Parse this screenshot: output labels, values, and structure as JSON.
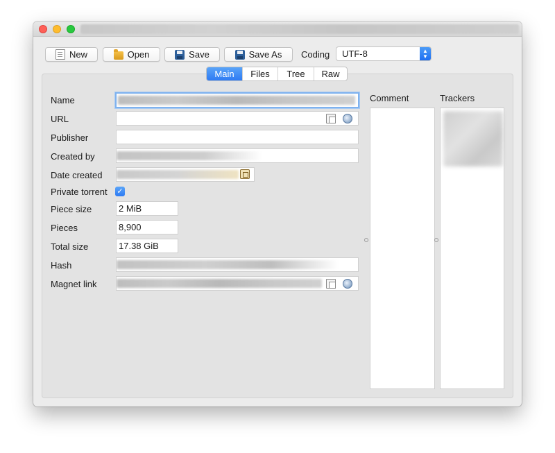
{
  "window": {
    "title": ""
  },
  "toolbar": {
    "new_label": "New",
    "open_label": "Open",
    "save_label": "Save",
    "save_as_label": "Save As",
    "coding_label": "Coding",
    "coding_value": "UTF-8"
  },
  "tabs": [
    {
      "label": "Main",
      "active": true
    },
    {
      "label": "Files",
      "active": false
    },
    {
      "label": "Tree",
      "active": false
    },
    {
      "label": "Raw",
      "active": false
    }
  ],
  "form": {
    "name_label": "Name",
    "url_label": "URL",
    "publisher_label": "Publisher",
    "created_by_label": "Created by",
    "date_created_label": "Date created",
    "private_label": "Private torrent",
    "private_checked": true,
    "piece_size_label": "Piece size",
    "piece_size_value": "2 MiB",
    "pieces_label": "Pieces",
    "pieces_value": "8,900",
    "total_size_label": "Total size",
    "total_size_value": "17.38 GiB",
    "hash_label": "Hash",
    "magnet_label": "Magnet link"
  },
  "side": {
    "comment_label": "Comment",
    "trackers_label": "Trackers"
  },
  "colors": {
    "accent": "#2e7bf3",
    "focus_ring": "#7fb2ee"
  }
}
